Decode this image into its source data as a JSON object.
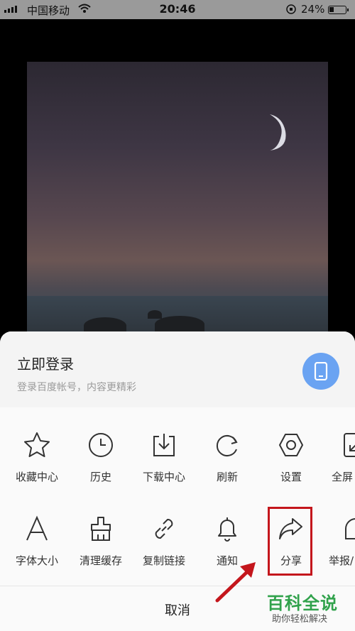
{
  "status_bar": {
    "carrier": "中国移动",
    "time": "20:46",
    "battery_percent": "24%"
  },
  "login": {
    "title": "立即登录",
    "subtitle": "登录百度帐号，内容更精彩"
  },
  "menu_row1": [
    {
      "label": "收藏中心",
      "icon": "star-icon"
    },
    {
      "label": "历史",
      "icon": "clock-icon"
    },
    {
      "label": "下载中心",
      "icon": "download-icon"
    },
    {
      "label": "刷新",
      "icon": "refresh-icon"
    },
    {
      "label": "设置",
      "icon": "settings-icon"
    },
    {
      "label": "全屏",
      "icon": "fullscreen-icon"
    }
  ],
  "menu_row2": [
    {
      "label": "字体大小",
      "icon": "font-size-icon"
    },
    {
      "label": "清理缓存",
      "icon": "broom-icon"
    },
    {
      "label": "复制链接",
      "icon": "link-icon"
    },
    {
      "label": "通知",
      "icon": "bell-icon"
    },
    {
      "label": "分享",
      "icon": "share-icon"
    },
    {
      "label": "举报/",
      "icon": "report-icon"
    }
  ],
  "cancel_label": "取消",
  "watermark": {
    "title": "百科全说",
    "subtitle": "助你轻松解决"
  },
  "colors": {
    "accent_blue": "#6aa3f2",
    "highlight_red": "#c4161c",
    "watermark_green": "#31a24c"
  }
}
